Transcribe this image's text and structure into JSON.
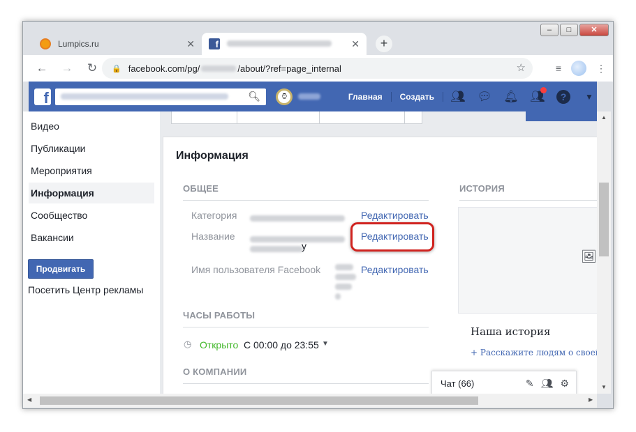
{
  "browser": {
    "tabs": [
      {
        "title": "Lumpics.ru"
      },
      {
        "title": ""
      }
    ],
    "address": "facebook.com/pg/",
    "address_tail": "/about/?ref=page_internal",
    "new_tab_symbol": "+"
  },
  "fb_header": {
    "logo": "f",
    "nav": [
      "Главная",
      "Создать"
    ]
  },
  "sidebar": {
    "items": [
      "Видео",
      "Публикации",
      "Мероприятия",
      "Информация",
      "Сообщество",
      "Вакансии"
    ],
    "active_index": 3,
    "promote_label": "Продвигать",
    "ads_link": "Посетить Центр рекламы"
  },
  "info": {
    "title": "Информация",
    "general": {
      "heading": "ОБЩЕЕ",
      "rows": [
        {
          "label": "Категория",
          "edit": "Редактировать"
        },
        {
          "label": "Название",
          "edit": "Редактировать",
          "partial_value": "у"
        },
        {
          "label": "Имя пользователя Facebook",
          "edit": "Редактировать"
        }
      ]
    },
    "hours": {
      "heading": "ЧАСЫ РАБОТЫ",
      "status": "Открыто",
      "range": "С 00:00 до 23:55"
    },
    "company_heading": "О КОМПАНИИ",
    "history": {
      "heading": "ИСТОРИЯ",
      "title": "Наша история",
      "link": "+ Расскажите людям о своей"
    }
  },
  "chat": {
    "label": "Чат (66)"
  },
  "colors": {
    "fb_blue": "#4267b2",
    "highlight_red": "#d0231f",
    "open_green": "#42b72a"
  }
}
